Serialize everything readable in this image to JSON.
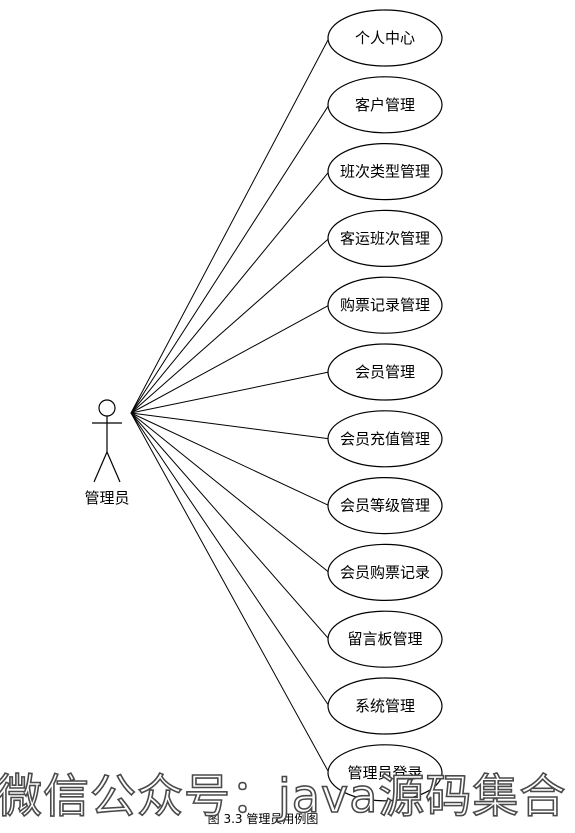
{
  "actor": {
    "label": "管理员"
  },
  "use_cases": [
    "个人中心",
    "客户管理",
    "班次类型管理",
    "客运班次管理",
    "购票记录管理",
    "会员管理",
    "会员充值管理",
    "会员等级管理",
    "会员购票记录",
    "留言板管理",
    "系统管理",
    "管理员登录"
  ],
  "caption": "图 3.3 管理员用例图",
  "watermark": "微信公众号：java源码集合",
  "colors": {
    "line": "#000000",
    "background": "#ffffff"
  }
}
